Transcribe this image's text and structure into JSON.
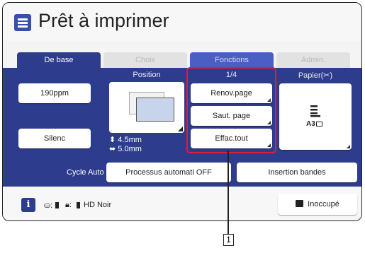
{
  "title": "Prêt à imprimer",
  "tabs": [
    {
      "label": "De base"
    },
    {
      "label": "Choix"
    },
    {
      "label": "Fonctions"
    },
    {
      "label": "Admin."
    }
  ],
  "columns": {
    "position_label": "Position",
    "page_indicator": "1/4",
    "paper_label": "Papier(✂︎)"
  },
  "left_buttons": {
    "speed": "190ppm",
    "silent": "Silenc"
  },
  "position": {
    "vertical_offset": "4.5mm",
    "horizontal_offset": "5.0mm"
  },
  "function_buttons": [
    "Renov.page",
    "Saut. page",
    "Effac.tout"
  ],
  "paper": {
    "size": "A3"
  },
  "cycle": {
    "label": "Cycle Auto",
    "auto_process_button": "Processus automati OFF",
    "insert_strips_button": "Insertion bandes"
  },
  "status_bar": {
    "mode": "HD Noir",
    "idle_button": "Inoccupé"
  },
  "callout": {
    "number": "1"
  },
  "colors": {
    "panel_blue": "#2e3c8e",
    "highlight_red": "#e11f2d"
  }
}
